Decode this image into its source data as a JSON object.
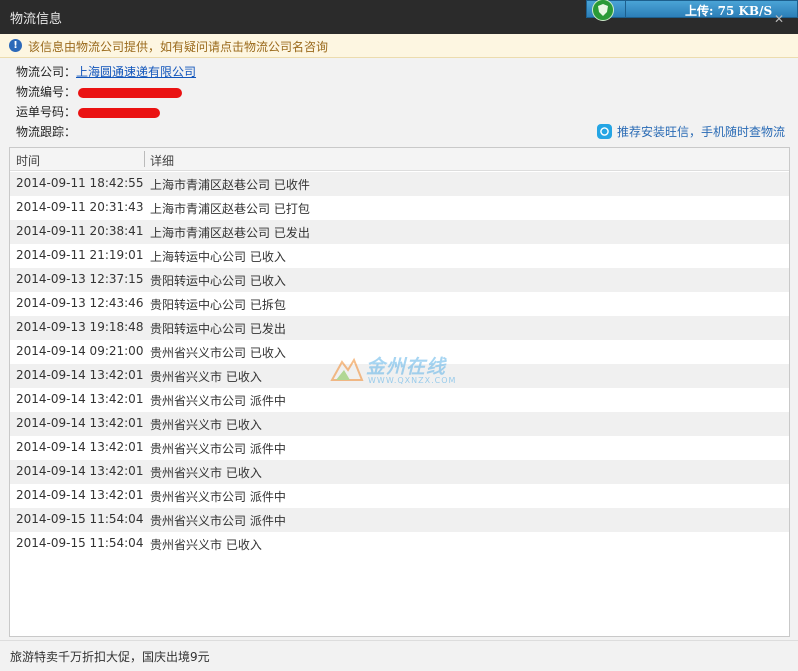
{
  "window": {
    "title": "物流信息",
    "close_glyph": "✕"
  },
  "upload": {
    "label": "上传: 75 KB/S",
    "icon": "shield-icon"
  },
  "notice": {
    "icon": "info-icon",
    "text": "该信息由物流公司提供，如有疑问请点击物流公司名咨询"
  },
  "info": {
    "company_label": "物流公司：",
    "company_name": "上海圆通速递有限公司",
    "logistics_no_label": "物流编号：",
    "waybill_label": "运单号码：",
    "tracking_label": "物流跟踪："
  },
  "wangxin": {
    "icon": "chat-icon",
    "text": "推荐安装旺信，手机随时查物流"
  },
  "table": {
    "headers": [
      "时间",
      "详细"
    ],
    "rows": [
      {
        "time": "2014-09-11 18:42:55",
        "detail": "上海市青浦区赵巷公司 已收件"
      },
      {
        "time": "2014-09-11 20:31:43",
        "detail": "上海市青浦区赵巷公司 已打包"
      },
      {
        "time": "2014-09-11 20:38:41",
        "detail": "上海市青浦区赵巷公司 已发出"
      },
      {
        "time": "2014-09-11 21:19:01",
        "detail": "上海转运中心公司 已收入"
      },
      {
        "time": "2014-09-13 12:37:15",
        "detail": "贵阳转运中心公司 已收入"
      },
      {
        "time": "2014-09-13 12:43:46",
        "detail": "贵阳转运中心公司 已拆包"
      },
      {
        "time": "2014-09-13 19:18:48",
        "detail": "贵阳转运中心公司 已发出"
      },
      {
        "time": "2014-09-14 09:21:00",
        "detail": "贵州省兴义市公司 已收入"
      },
      {
        "time": "2014-09-14 13:42:01",
        "detail": "贵州省兴义市 已收入"
      },
      {
        "time": "2014-09-14 13:42:01",
        "detail": "贵州省兴义市公司 派件中"
      },
      {
        "time": "2014-09-14 13:42:01",
        "detail": "贵州省兴义市 已收入"
      },
      {
        "time": "2014-09-14 13:42:01",
        "detail": "贵州省兴义市公司 派件中"
      },
      {
        "time": "2014-09-14 13:42:01",
        "detail": "贵州省兴义市 已收入"
      },
      {
        "time": "2014-09-14 13:42:01",
        "detail": "贵州省兴义市公司 派件中"
      },
      {
        "time": "2014-09-15 11:54:04",
        "detail": "贵州省兴义市公司 派件中"
      },
      {
        "time": "2014-09-15 11:54:04",
        "detail": "贵州省兴义市 已收入"
      }
    ]
  },
  "watermark": {
    "text": "金州在线",
    "sub": "WWW.QXNZX.COM"
  },
  "footer": {
    "text": "旅游特卖千万折扣大促，国庆出境9元"
  },
  "colors": {
    "notice_bg": "#fdf6e1",
    "link": "#1155bb",
    "redaction": "#ea1212"
  }
}
